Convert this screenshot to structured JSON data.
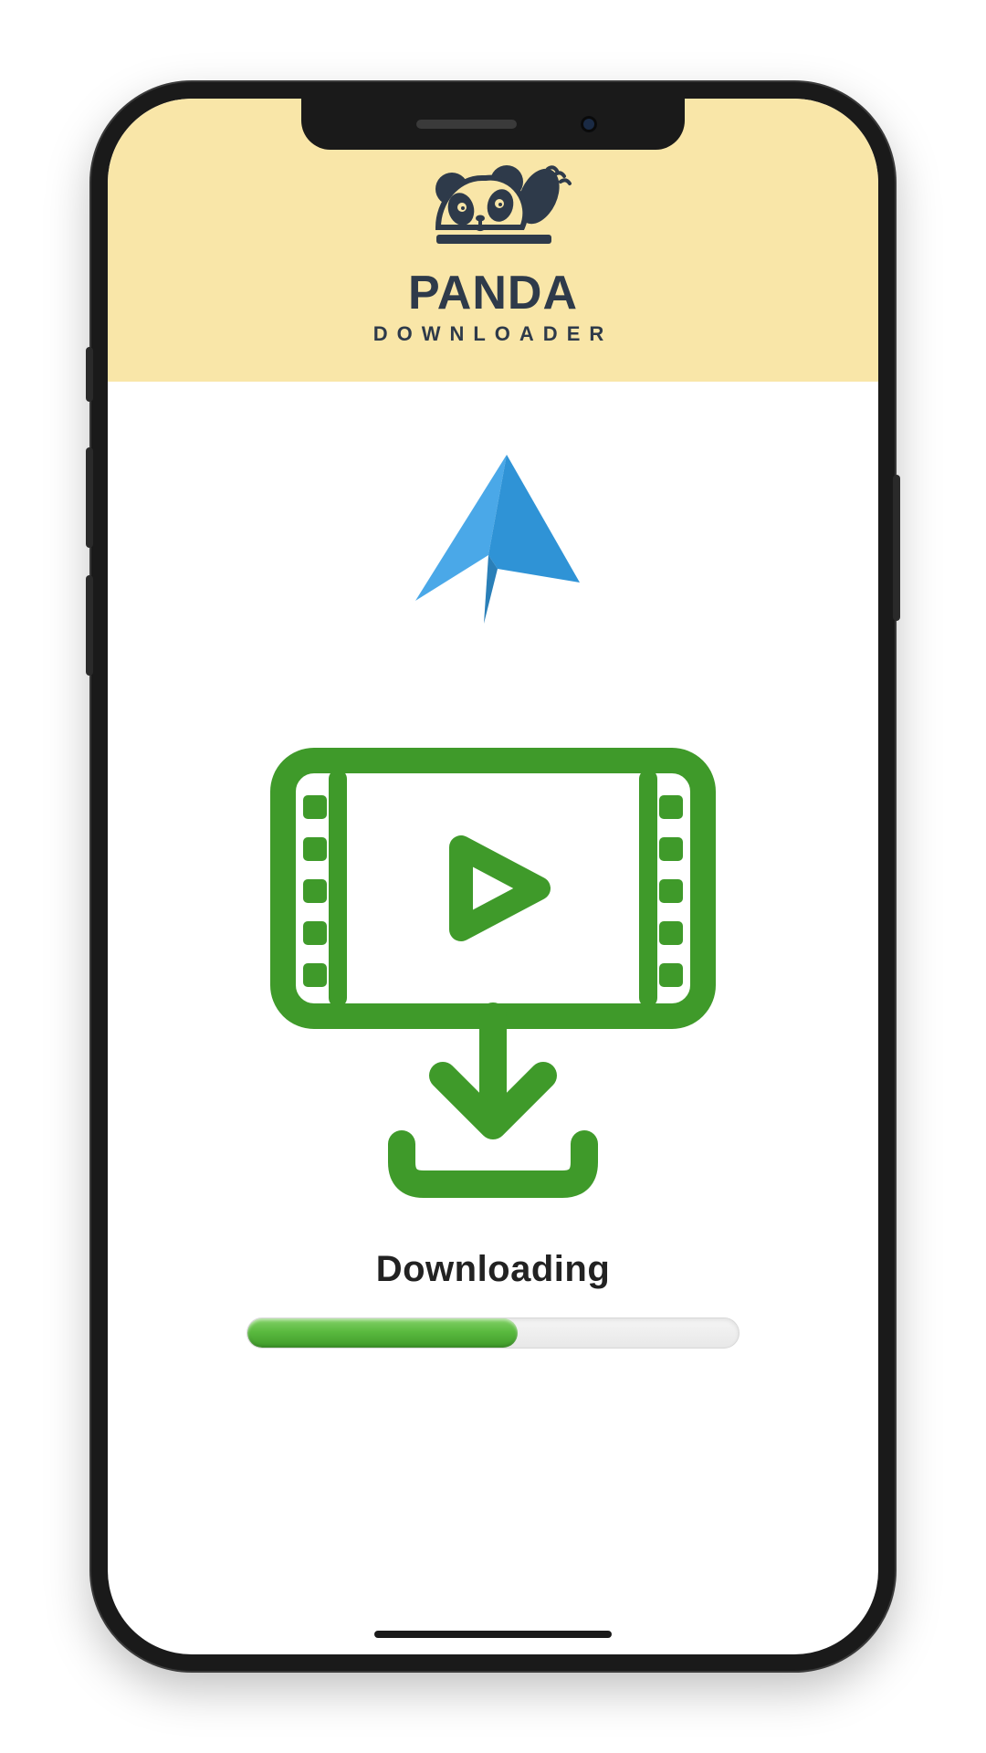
{
  "brand": {
    "title": "PANDA",
    "subtitle": "DOWNLOADER"
  },
  "status": {
    "label": "Downloading",
    "progress_percent": 55
  },
  "icons": {
    "plane": "paper-plane-icon",
    "video_download": "video-download-icon",
    "logo_panda": "panda-logo-icon"
  },
  "colors": {
    "header_bg": "#f9e6a8",
    "accent_green": "#3f9a2a",
    "accent_blue": "#2f93d6",
    "brand_dark": "#2e3a4a"
  }
}
